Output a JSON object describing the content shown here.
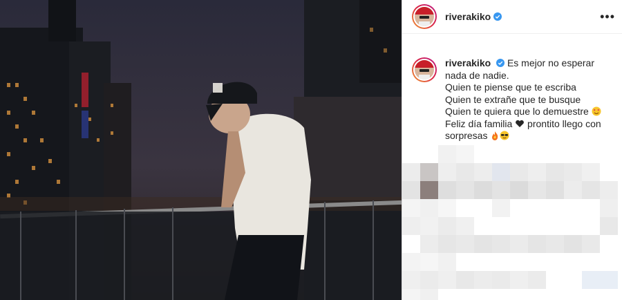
{
  "post": {
    "username": "riverakiko",
    "verified": true,
    "more_label": "•••"
  },
  "caption": {
    "username": "riverakiko",
    "first_line": "Es mejor no esperar nada de nadie.",
    "lines": [
      "Quien te piense que te escriba",
      "Quien te extrañe que te busque",
      "Quien te quiera que lo demuestre"
    ],
    "line5_a": "Feliz día familia",
    "line5_b": "prontito llego con",
    "line6": "sorpresas"
  },
  "icons": {
    "verified": "verified-badge-icon",
    "heart_eyes": "heart-eyes-emoji",
    "black_heart": "black-heart-emoji",
    "fire": "fire-emoji",
    "sunglasses": "sunglasses-emoji",
    "more": "more-options-icon"
  },
  "colors": {
    "verified": "#3897f0",
    "text": "#262626",
    "story_ring": "#dc2743"
  }
}
